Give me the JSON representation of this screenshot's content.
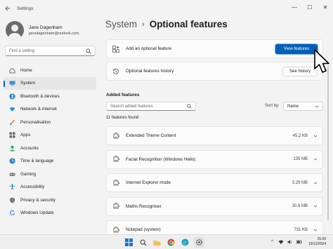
{
  "window": {
    "title": "Settings",
    "back_icon": "arrow-left-icon",
    "minimize_glyph": "—",
    "maximize_glyph": "☐",
    "close_glyph": "✕"
  },
  "profile": {
    "name": "Jane Dagenham",
    "email": "janedagenham@outlook.com"
  },
  "search": {
    "placeholder": "Find a setting",
    "icon": "search-icon"
  },
  "sidebar": {
    "items": [
      {
        "label": "Home",
        "icon": "home-icon",
        "active": false
      },
      {
        "label": "System",
        "icon": "system-monitor-icon",
        "active": true
      },
      {
        "label": "Bluetooth & devices",
        "icon": "bluetooth-icon",
        "active": false
      },
      {
        "label": "Network & internet",
        "icon": "wifi-icon",
        "active": false
      },
      {
        "label": "Personalisation",
        "icon": "brush-icon",
        "active": false
      },
      {
        "label": "Apps",
        "icon": "apps-icon",
        "active": false
      },
      {
        "label": "Accounts",
        "icon": "person-icon",
        "active": false
      },
      {
        "label": "Time & language",
        "icon": "globe-clock-icon",
        "active": false
      },
      {
        "label": "Gaming",
        "icon": "gamepad-icon",
        "active": false
      },
      {
        "label": "Accessibility",
        "icon": "accessibility-icon",
        "active": false
      },
      {
        "label": "Privacy & security",
        "icon": "shield-icon",
        "active": false
      },
      {
        "label": "Windows Update",
        "icon": "update-icon",
        "active": false
      }
    ]
  },
  "breadcrumb": {
    "root": "System",
    "separator": "›",
    "current": "Optional features"
  },
  "cards": {
    "add": {
      "label": "Add an optional feature",
      "button": "View features"
    },
    "history": {
      "label": "Optional features history",
      "button": "See history"
    }
  },
  "added": {
    "title": "Added features",
    "search_placeholder": "Search added features",
    "sort_label": "Sort by:",
    "sort_value": "Name",
    "count": "11 features found",
    "features": [
      {
        "name": "Extended Theme Content",
        "size": "45.2 KB"
      },
      {
        "name": "Facial Recognition (Windows Hello)",
        "size": "135 MB"
      },
      {
        "name": "Internet Explorer mode",
        "size": "3.29 MB"
      },
      {
        "name": "Maths Recogniser",
        "size": "30.6 MB"
      },
      {
        "name": "Notepad (system)",
        "size": "731 KB"
      }
    ]
  },
  "taskbar": {
    "time": "15:20",
    "date": "19/12/2024",
    "tray_caret": "^"
  },
  "colors": {
    "accent": "#005fb8",
    "background": "#f3f3f3",
    "card": "#fbfbfb"
  }
}
